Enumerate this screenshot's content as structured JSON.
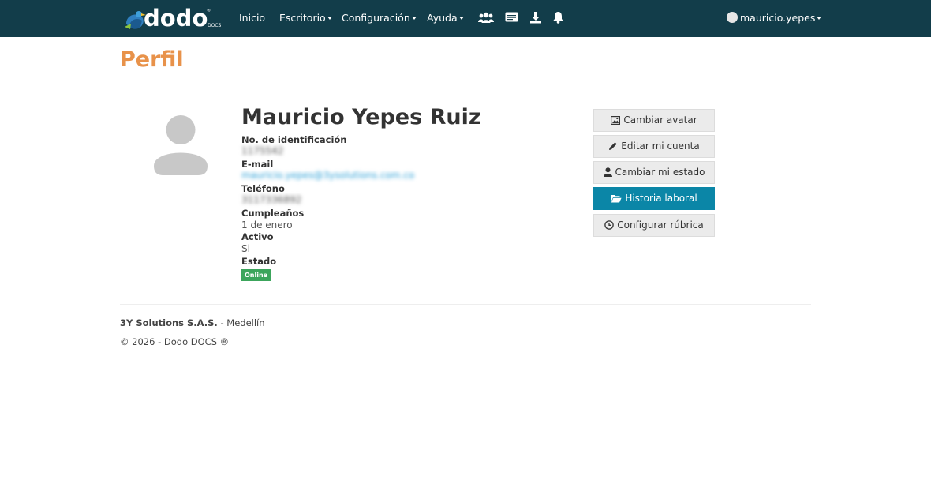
{
  "navbar": {
    "logo_text": "dodo",
    "logo_sub": "DOCS",
    "logo_reg": "®",
    "items": [
      {
        "label": "Inicio",
        "dropdown": false
      },
      {
        "label": "Escritorio",
        "dropdown": true
      },
      {
        "label": "Configuración",
        "dropdown": true
      },
      {
        "label": "Ayuda",
        "dropdown": true
      }
    ],
    "icons": [
      "users-icon",
      "id-card-icon",
      "download-icon",
      "bell-icon"
    ],
    "user": "mauricio.yepes"
  },
  "page": {
    "title": "Perfil"
  },
  "profile": {
    "name": "Mauricio Yepes Ruiz",
    "id_label": "No. de identificación",
    "id_value": "1175542",
    "email_label": "E-mail",
    "email_value": "mauricio.yepes@3ysolutions.com.co",
    "phone_label": "Teléfono",
    "phone_value": "3117336892",
    "birthday_label": "Cumpleaños",
    "birthday_value": "1 de enero",
    "active_label": "Activo",
    "active_value": "Si",
    "status_label": "Estado",
    "status_value": "Online"
  },
  "actions": {
    "change_avatar": "Cambiar avatar",
    "edit_account": "Editar mi cuenta",
    "change_status": "Cambiar mi estado",
    "work_history": "Historia laboral",
    "configure_rubric": "Configurar rúbrica"
  },
  "footer": {
    "company": "3Y Solutions S.A.S.",
    "city": "- Medellín",
    "copyright": "© 2026 - Dodo DOCS ®"
  },
  "colors": {
    "navbar": "#123d4a",
    "title": "#e8924a",
    "primary_button": "#0b86a7",
    "badge": "#3ca55c"
  }
}
